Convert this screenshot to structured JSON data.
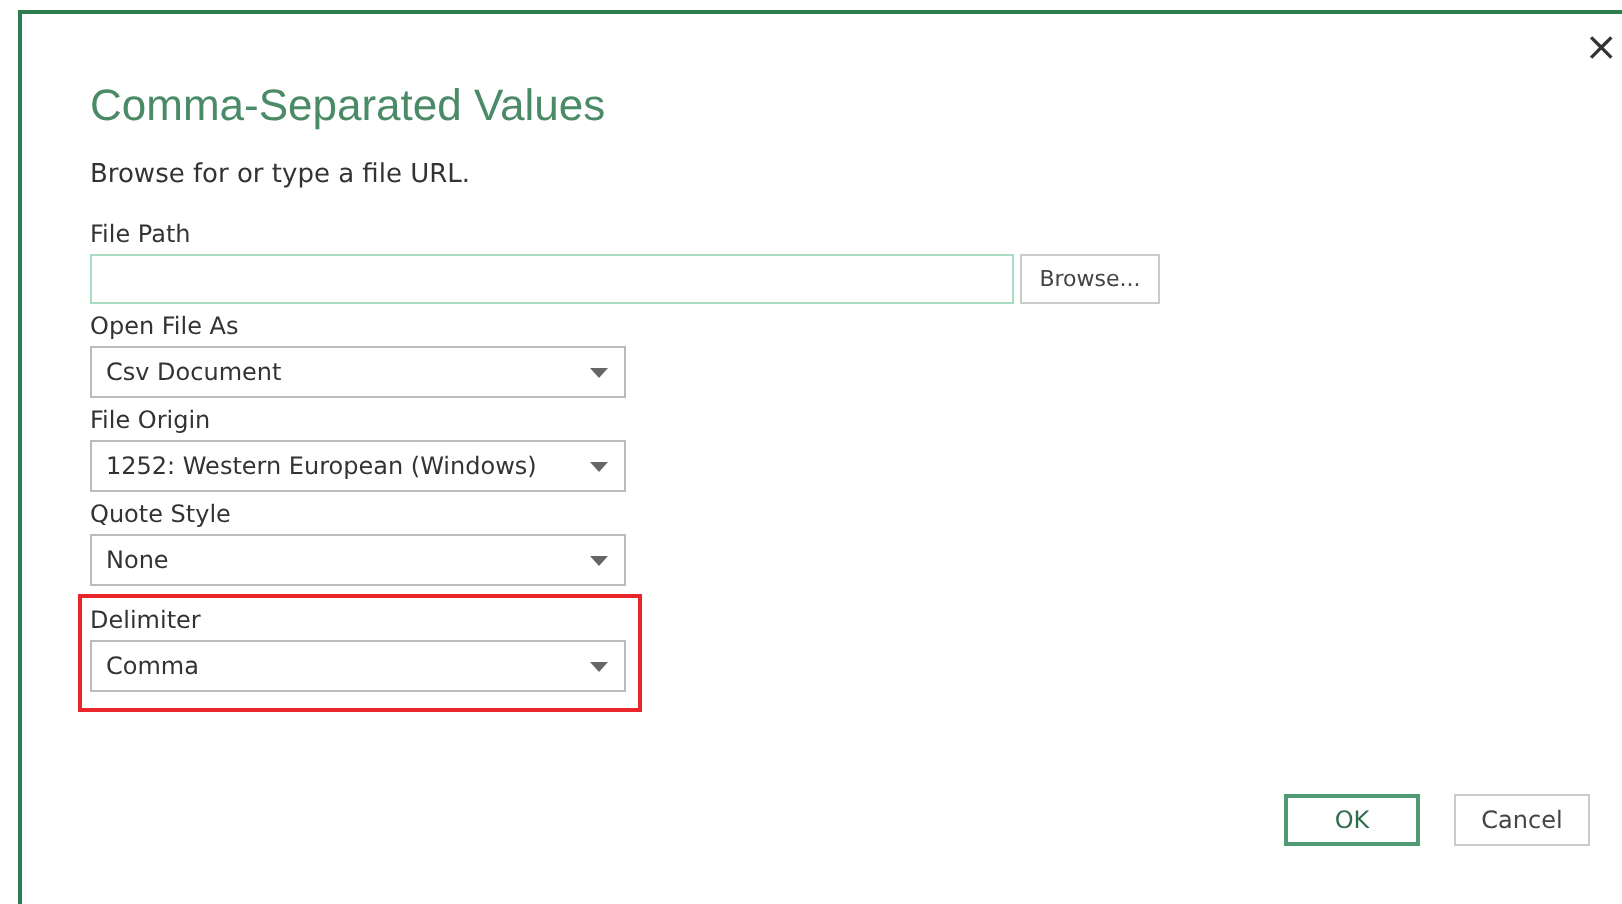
{
  "dialog": {
    "title": "Comma-Separated Values",
    "subtitle": "Browse for or type a file URL.",
    "close": "×"
  },
  "fields": [
    {
      "kind": "text",
      "label": "File Path",
      "button": "Browse..."
    },
    {
      "kind": "select",
      "label": "Open File As",
      "value": "Csv Document"
    },
    {
      "kind": "select",
      "label": "File Origin",
      "value": "1252: Western European (Windows)"
    },
    {
      "kind": "select",
      "label": "Quote Style",
      "value": "None"
    }
  ],
  "highlight_frame": {
    "fields": [
      {
        "kind": "select",
        "label": "Delimiter",
        "value": "Comma"
      }
    ]
  },
  "buttons": [
    {
      "label": "OK",
      "primary": true
    },
    {
      "label": "Cancel",
      "primary": false
    }
  ]
}
